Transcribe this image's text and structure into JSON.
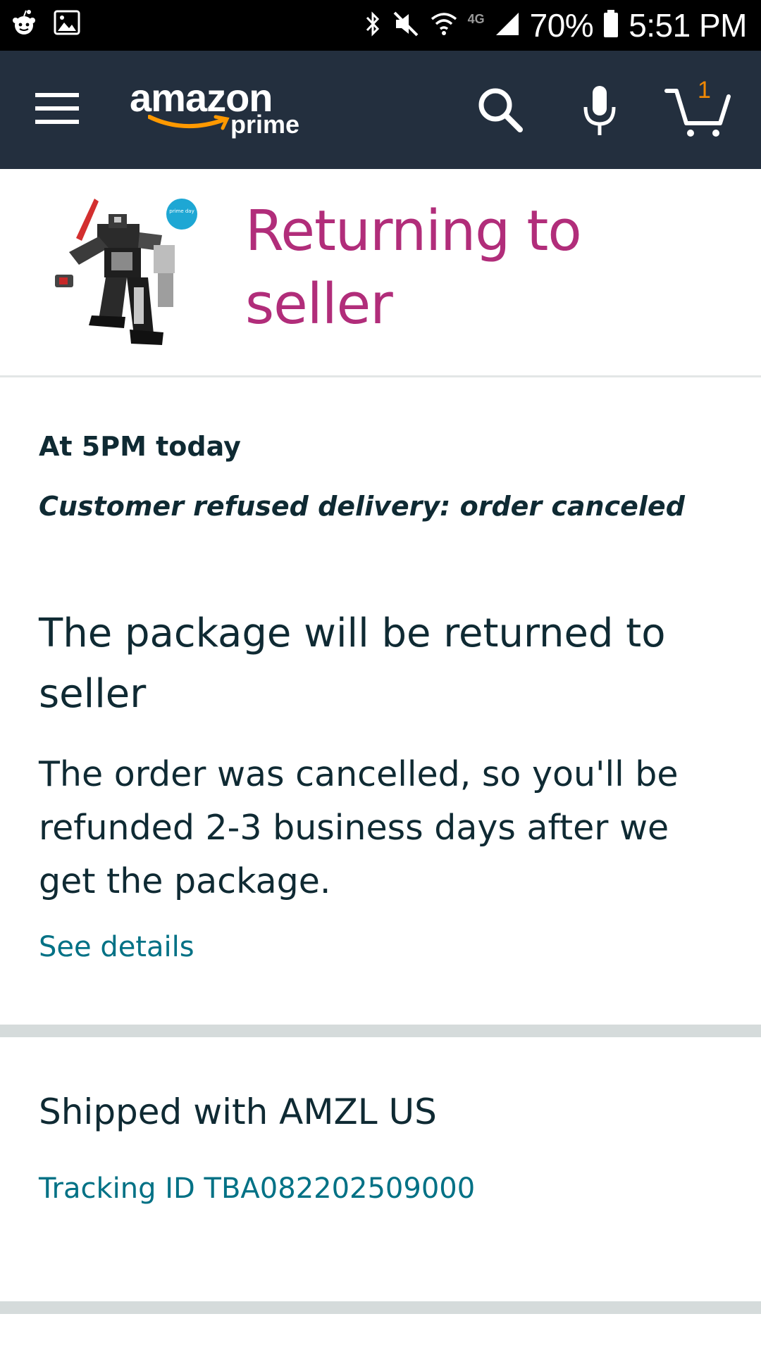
{
  "status_bar": {
    "battery": "70%",
    "time": "5:51 PM",
    "network": "4G",
    "icons": [
      "reddit-icon",
      "gallery-icon",
      "bluetooth-icon",
      "mute-icon",
      "wifi-icon",
      "signal-icon",
      "battery-icon"
    ]
  },
  "header": {
    "logo_word": "amazon",
    "logo_sub": "prime",
    "cart_count": "1",
    "colors": {
      "background": "#232f3e",
      "cart_accent": "#f08804",
      "smile": "#ff9900"
    }
  },
  "product": {
    "status": "Returning to seller",
    "badge_text": "prime day",
    "status_color": "#b12d7a"
  },
  "event": {
    "time": "At 5PM today",
    "description": "Customer refused delivery: order canceled"
  },
  "message": {
    "heading": "The package will be returned to seller",
    "body": "The order was cancelled, so you'll be refunded 2-3 business days after we get the package.",
    "link": "See details"
  },
  "shipping": {
    "carrier_text": "Shipped with AMZL US",
    "tracking_text": "Tracking ID TBA082202509000",
    "link_color": "#007185"
  }
}
